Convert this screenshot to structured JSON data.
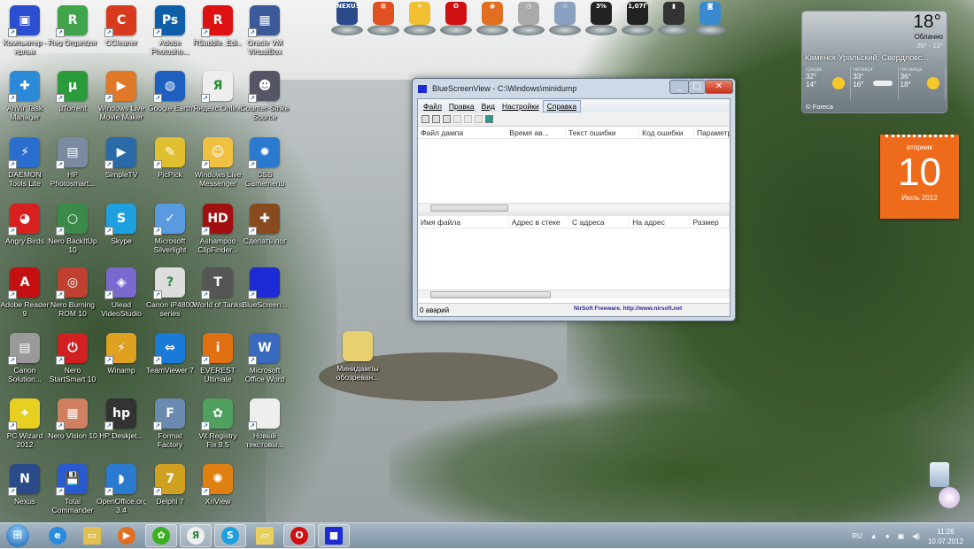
{
  "desktop_icons": [
    {
      "label": "Компьютер - ярлык",
      "color": "#2a4fd0",
      "glyph": "▣"
    },
    {
      "label": "Reg Organizer",
      "color": "#3fa44a",
      "glyph": "R"
    },
    {
      "label": "CCleaner",
      "color": "#d83a1e",
      "glyph": "C"
    },
    {
      "label": "Adobe Photosho...",
      "color": "#0f5fa8",
      "glyph": "Ps"
    },
    {
      "label": "RSaddle_Edi...",
      "color": "#d11",
      "glyph": "R"
    },
    {
      "label": "Oracle VM VirtualBox",
      "color": "#3a5a99",
      "glyph": "▦"
    },
    {
      "label": "AnVir Task Manager",
      "color": "#2a8ad8",
      "glyph": "✚"
    },
    {
      "label": "µTorrent",
      "color": "#2a9a3a",
      "glyph": "µ"
    },
    {
      "label": "Windows Live Movie Maker",
      "color": "#e07828",
      "glyph": "▶"
    },
    {
      "label": "Google Earth",
      "color": "#1f5fc0",
      "glyph": "◍"
    },
    {
      "label": "Яндекс.Online",
      "color": "#eee",
      "glyph": "Я"
    },
    {
      "label": "Counter-Strike Source",
      "color": "#556",
      "glyph": "☻"
    },
    {
      "label": "DAEMON Tools Lite",
      "color": "#2a6ed0",
      "glyph": "⚡"
    },
    {
      "label": "HP Photosmart...",
      "color": "#7a8aa0",
      "glyph": "▤"
    },
    {
      "label": "SimpleTV",
      "color": "#2a6aa8",
      "glyph": "▶"
    },
    {
      "label": "PicPick",
      "color": "#e0c030",
      "glyph": "✎"
    },
    {
      "label": "Windows Live Messenger",
      "color": "#f0c040",
      "glyph": "☺"
    },
    {
      "label": "CSS Gamemenu",
      "color": "#2a7ad0",
      "glyph": "✹"
    },
    {
      "label": "Angry Birds",
      "color": "#d82020",
      "glyph": "◕"
    },
    {
      "label": "Nero BackItUp 10",
      "color": "#3a8a4a",
      "glyph": "○"
    },
    {
      "label": "Skype",
      "color": "#1ea0e0",
      "glyph": "S"
    },
    {
      "label": "Microsoft Silverlight",
      "color": "#5a9ae0",
      "glyph": "✓"
    },
    {
      "label": "Ashampoo ClipFinder...",
      "color": "#a01010",
      "glyph": "HD"
    },
    {
      "label": "Сделать лог",
      "color": "#8a4a20",
      "glyph": "✚"
    },
    {
      "label": "Adobe Reader 9",
      "color": "#c41010",
      "glyph": "A"
    },
    {
      "label": "Nero Burning ROM 10",
      "color": "#c04030",
      "glyph": "◎"
    },
    {
      "label": "Ulead VideoStudio",
      "color": "#7a6ad0",
      "glyph": "◈"
    },
    {
      "label": "Canon iP4800 series Screen...",
      "color": "#ddd",
      "glyph": "?"
    },
    {
      "label": "World of Tanks",
      "color": "#555",
      "glyph": "T"
    },
    {
      "label": "BlueScreen...",
      "color": "#1c2bd6",
      "glyph": ""
    },
    {
      "label": "Canon Solution...",
      "color": "#999",
      "glyph": "▤"
    },
    {
      "label": "Nero StartSmart 10",
      "color": "#d02020",
      "glyph": "⏻"
    },
    {
      "label": "Winamp",
      "color": "#e0a020",
      "glyph": "⚡"
    },
    {
      "label": "TeamViewer 7",
      "color": "#1a7ad8",
      "glyph": "⇔"
    },
    {
      "label": "EVEREST Ultimate",
      "color": "#e07010",
      "glyph": "i"
    },
    {
      "label": "Microsoft Office Word",
      "color": "#3a6ac0",
      "glyph": "W"
    },
    {
      "label": "PC Wizard 2012",
      "color": "#e8d020",
      "glyph": "✦"
    },
    {
      "label": "Nero Vision 10",
      "color": "#d08060",
      "glyph": "▦"
    },
    {
      "label": "HP Deskjet...",
      "color": "#333",
      "glyph": "hp"
    },
    {
      "label": "Format Factory",
      "color": "#6a8ab0",
      "glyph": "F"
    },
    {
      "label": "Vit Registry Fix 9.5",
      "color": "#50a060",
      "glyph": "✿"
    },
    {
      "label": "Новый текстовы...",
      "color": "#eee",
      "glyph": ""
    },
    {
      "label": "Nexus",
      "color": "#2a4a8a",
      "glyph": "N"
    },
    {
      "label": "Total Commander",
      "color": "#2a5ad0",
      "glyph": "💾"
    },
    {
      "label": "OpenOffice.org 3.4",
      "color": "#2a7ad0",
      "glyph": "◗"
    },
    {
      "label": "Delphi 7",
      "color": "#d0a020",
      "glyph": "7"
    },
    {
      "label": "XnView",
      "color": "#e08010",
      "glyph": "✺"
    },
    {
      "label": "Минидампы обозреван...",
      "color": "#e8d070",
      "glyph": ""
    }
  ],
  "dock_items": [
    {
      "name": "nexus",
      "color": "#2a4a8a",
      "text": "NEXUS"
    },
    {
      "name": "windows",
      "color": "#e05020",
      "text": "⊞"
    },
    {
      "name": "weather",
      "color": "#f0c030",
      "text": "☀"
    },
    {
      "name": "opera",
      "color": "#d01010",
      "text": "O"
    },
    {
      "name": "firefox",
      "color": "#e07020",
      "text": "◉"
    },
    {
      "name": "clock",
      "color": "#aaa",
      "text": "◷"
    },
    {
      "name": "recycle-bin",
      "color": "#8aa0c0",
      "text": "♲"
    },
    {
      "name": "cpu-meter",
      "color": "#222",
      "text": "3%"
    },
    {
      "name": "memory-meter",
      "color": "#222",
      "text": "1,07Г"
    },
    {
      "name": "drive",
      "color": "#333",
      "text": "▮"
    },
    {
      "name": "photo",
      "color": "#3a8ad0",
      "text": "◙"
    }
  ],
  "window": {
    "title": "BlueScreenView  -  C:\\Windows\\minidump",
    "menu": [
      "Файл",
      "Правка",
      "Вид",
      "Настройки",
      "Справка"
    ],
    "upper_columns": [
      "Файл дампа",
      "Время ав...",
      "Текст ошибки",
      "Код ошибки",
      "Параметр"
    ],
    "lower_columns": [
      "Имя файла",
      "Адрес в стеке",
      "С адреса",
      "На адрес",
      "Размер"
    ],
    "status": "0 аварий",
    "credit": "NirSoft Freeware.  http://www.nirsoft.net"
  },
  "weather": {
    "temp": "18°",
    "condition": "Облачно",
    "hi": "20°",
    "lo": "12°",
    "location": "Каменск-Уральский, Свердловс...",
    "forecast": [
      {
        "day": "среда",
        "hi": "32°",
        "lo": "14°",
        "icon": "sun"
      },
      {
        "day": "четверг",
        "hi": "33°",
        "lo": "16°",
        "icon": "cloud"
      },
      {
        "day": "пятница",
        "hi": "36°",
        "lo": "18°",
        "icon": "sun"
      }
    ],
    "source": "© Foreca"
  },
  "calendar": {
    "weekday": "вторник",
    "day": "10",
    "month_year": "Июль 2012",
    "color": "#ef6b1c"
  },
  "taskbar": {
    "items": [
      {
        "name": "internet-explorer",
        "color": "#2a8ae0",
        "glyph": "e",
        "running": false
      },
      {
        "name": "explorer",
        "color": "#e0c050",
        "glyph": "▭",
        "running": false
      },
      {
        "name": "media-player",
        "color": "#e07020",
        "glyph": "▶",
        "running": false
      },
      {
        "name": "icq",
        "color": "#3ab020",
        "glyph": "✿",
        "running": true
      },
      {
        "name": "yandex",
        "color": "#eee",
        "glyph": "Я",
        "running": true
      },
      {
        "name": "skype",
        "color": "#1ea0e0",
        "glyph": "S",
        "running": true
      },
      {
        "name": "sticky-notes",
        "color": "#e8d060",
        "glyph": "▱",
        "running": false
      },
      {
        "name": "opera",
        "color": "#d01010",
        "glyph": "O",
        "running": true
      },
      {
        "name": "bluescreenview",
        "color": "#1c2bd6",
        "glyph": "■",
        "running": true
      }
    ],
    "language": "RU",
    "time": "11:26",
    "date": "10.07.2012"
  }
}
